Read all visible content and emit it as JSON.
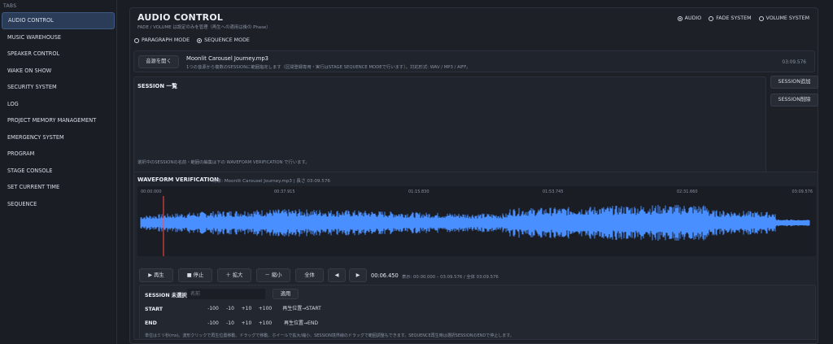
{
  "sidebar": {
    "title": "TABS",
    "items": [
      {
        "label": "AUDIO CONTROL"
      },
      {
        "label": "MUSIC WAREHOUSE"
      },
      {
        "label": "SPEAKER CONTROL"
      },
      {
        "label": "WAKE ON SHOW"
      },
      {
        "label": "SECURITY SYSTEM"
      },
      {
        "label": "LOG"
      },
      {
        "label": "PROJECT MEMORY MANAGEMENT"
      },
      {
        "label": "EMERGENCY SYSTEM"
      },
      {
        "label": "PROGRAM"
      },
      {
        "label": "STAGE CONSOLE"
      },
      {
        "label": "SET CURRENT TIME"
      },
      {
        "label": "SEQUENCE"
      }
    ],
    "active_index": 0
  },
  "header": {
    "title": "AUDIO CONTROL",
    "subtitle": "FADE / VOLUME は設定のみを管理（再生への適用は後の Phase）",
    "system_options": [
      "AUDIO",
      "FADE SYSTEM",
      "VOLUME SYSTEM"
    ],
    "system_selected": "AUDIO",
    "mode_options": [
      "PARAGRAPH MODE",
      "SEQUENCE MODE"
    ],
    "mode_selected": "SEQUENCE MODE"
  },
  "file": {
    "open_button": "音源を開く",
    "name": "Moonlit Carousel Journey.mp3",
    "description": "1つの音源から複数のSESSIONに範囲指定します（区間登録専用・実行はSTAGE SEQUENCE MODEで行います）。対応形式: WAV / MP3 / AIFF。",
    "duration": "03:09.576"
  },
  "sessions": {
    "title": "SESSION 一覧",
    "hint": "選択中のSESSIONの名前・範囲の編集は下の WAVEFORM VERIFICATION で行います。",
    "add_button": "SESSION追加",
    "delete_button": "SESSION削除"
  },
  "waveform": {
    "title": "WAVEFORM VERIFICATION",
    "target": "対象: Moonlit Carousel Journey.mp3 | 長さ 03:09.576",
    "ticks": [
      "00:00.000",
      "00:37.915",
      "01:15.830",
      "01:53.745",
      "02:31.660",
      "03:09.576"
    ],
    "color": "#4a8fff",
    "playhead_color": "#ff4d4d",
    "playhead_fraction": 0.034
  },
  "controls": {
    "play": "▶ 再生",
    "stop": "■ 停止",
    "zoom_in": "＋ 拡大",
    "zoom_out": "－ 縮小",
    "all": "全体",
    "prev": "◀",
    "next": "▶",
    "position": "00:06.450",
    "range": "表示: 00:00.000 – 03:09.576 / 全体 03:09.576"
  },
  "editor": {
    "session_label": "SESSION 未選択",
    "name_placeholder": "名前",
    "apply": "適用",
    "start_label": "START",
    "end_label": "END",
    "steps": [
      "-100",
      "-10",
      "+10",
      "+100"
    ],
    "set_start": "再生位置→START",
    "set_end": "再生位置→END",
    "note": "単位はミリ秒(ms)。波形クリックで再生位置移動、ドラッグで移動、ホイールで拡大/縮小、SESSION境界線のドラッグで範囲調整もできます。SEQUENCE再生時は選択SESSIONのENDで停止します。"
  }
}
